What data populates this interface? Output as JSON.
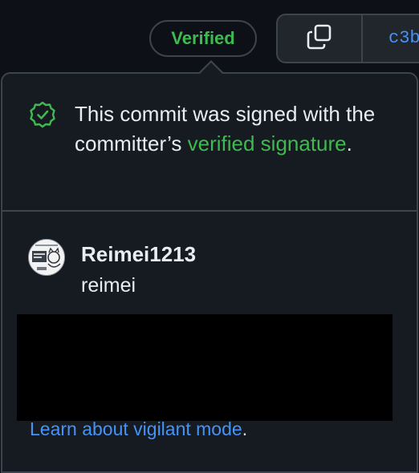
{
  "toolbar": {
    "verified_label": "Verified",
    "commit_sha": "c3b",
    "copy_icon": "copy-icon"
  },
  "popover": {
    "signature": {
      "icon": "verified-shield-icon",
      "text_prefix": "This commit was signed with the committer’s ",
      "link_label": "verified signature",
      "text_suffix": "."
    },
    "user": {
      "login": "Reimei1213",
      "name": "reimei"
    },
    "footer": {
      "link_label": "Learn about vigilant mode",
      "suffix": "."
    }
  },
  "colors": {
    "background": "#0d1117",
    "popover_bg": "#161b22",
    "border": "#3d444d",
    "verified_green": "#3fb950",
    "link_blue": "#4493f8",
    "text": "#e6edf3"
  }
}
